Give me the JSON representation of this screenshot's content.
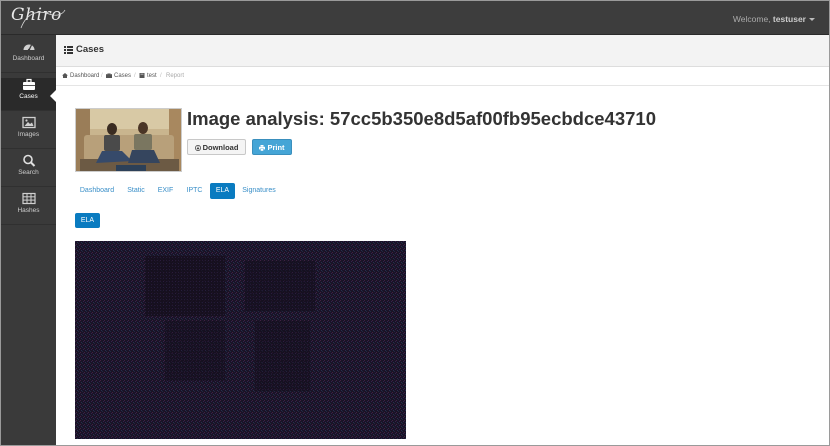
{
  "app": {
    "logo_text": "Ghiro",
    "welcome_prefix": "Welcome,",
    "username": "testuser"
  },
  "sidebar": {
    "items": [
      {
        "label": "Dashboard",
        "icon": "dashboard-icon"
      },
      {
        "label": "Cases",
        "icon": "briefcase-icon",
        "active": true
      },
      {
        "label": "Images",
        "icon": "image-icon"
      },
      {
        "label": "Search",
        "icon": "search-icon"
      },
      {
        "label": "Hashes",
        "icon": "table-icon"
      }
    ]
  },
  "header": {
    "title": "Cases",
    "icon": "list-icon"
  },
  "breadcrumb": {
    "items": [
      {
        "label": "Dashboard",
        "icon": "home-icon"
      },
      {
        "label": "Cases",
        "icon": "briefcase-icon"
      },
      {
        "label": "test",
        "icon": "book-icon"
      },
      {
        "label": "Report"
      }
    ]
  },
  "analysis": {
    "title": "Image analysis: 57cc5b350e8d5af00fb95ecbdce43710",
    "download_label": "Download",
    "print_label": "Print"
  },
  "tabs": [
    {
      "label": "Dashboard"
    },
    {
      "label": "Static"
    },
    {
      "label": "EXIF"
    },
    {
      "label": "IPTC"
    },
    {
      "label": "ELA",
      "active": true
    },
    {
      "label": "Signatures"
    }
  ],
  "ela_section": {
    "pill_label": "ELA"
  },
  "colors": {
    "topbar": "#3d3d3d",
    "sidebar": "#3a3a3a",
    "accent": "#0a7bc0",
    "print_button": "#45a5d6",
    "link": "#3a8fc8"
  }
}
